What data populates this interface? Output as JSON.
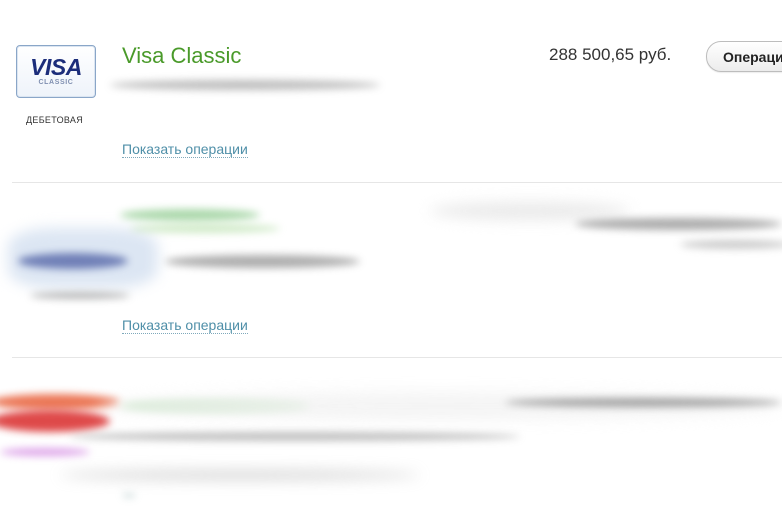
{
  "accounts": [
    {
      "logo": {
        "brand": "VISA",
        "sub": "CLASSIC"
      },
      "card_type": "ДЕБЕТОВАЯ",
      "name": "Visa Classic",
      "balance": "288 500,65 руб.",
      "ops_button": "Операции",
      "show_ops": "Показать операции"
    },
    {
      "show_ops": "Показать операции"
    }
  ],
  "colors": {
    "card_name": "#4a9a2a",
    "link": "#4f8fa8",
    "visa_blue": "#1c2d7a"
  }
}
